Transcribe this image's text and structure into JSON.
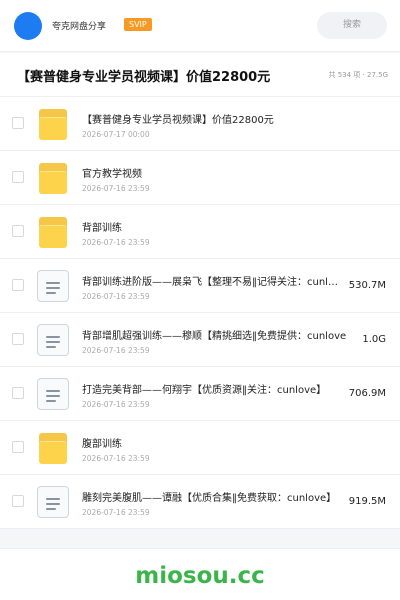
{
  "header": {
    "share_name": "夸克网盘分享",
    "badge": "SVIP",
    "search_label": "搜索",
    "avatar_color": "#1e7cf2",
    "badge_color": "#f79a23"
  },
  "share": {
    "title": "【赛普健身专业学员视频课】价值22800元",
    "meta": "共 534 项 · 27.5G"
  },
  "files": [
    {
      "type": "folder",
      "name": "【赛普健身专业学员视频课】价值22800元",
      "date": "2026-07-17 00:00",
      "size": ""
    },
    {
      "type": "folder",
      "name": "官方教学视频",
      "date": "2026-07-16 23:59",
      "size": ""
    },
    {
      "type": "folder",
      "name": "背部训练",
      "date": "2026-07-16 23:59",
      "size": ""
    },
    {
      "type": "file",
      "name": "背部训练进阶版——展枭飞【整理不易‖记得关注：cunlove",
      "date": "2026-07-16 23:59",
      "size": "530.7M"
    },
    {
      "type": "file",
      "name": "背部增肌超强训练——穆顺【精挑细选‖免费提供：cunlove",
      "date": "2026-07-16 23:59",
      "size": "1.0G"
    },
    {
      "type": "file",
      "name": "打造完美背部——何翔宇【优质资源‖关注：cunlove】",
      "date": "2026-07-16 23:59",
      "size": "706.9M"
    },
    {
      "type": "folder",
      "name": "腹部训练",
      "date": "2026-07-16 23:59",
      "size": ""
    },
    {
      "type": "file",
      "name": "雕刻完美腹肌——谭融【优质合集‖免费获取：cunlove】",
      "date": "2026-07-16 23:59",
      "size": "919.5M"
    }
  ],
  "watermark": "miosou.cc",
  "icons": {
    "folder": "folder-icon",
    "file": "document-icon"
  }
}
